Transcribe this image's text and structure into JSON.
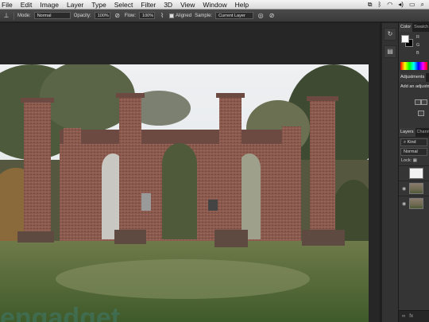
{
  "menubar": {
    "items": [
      "File",
      "Edit",
      "Image",
      "Layer",
      "Type",
      "Select",
      "Filter",
      "3D",
      "View",
      "Window",
      "Help"
    ],
    "status_icons": [
      "clone-icon",
      "bluetooth-icon",
      "wifi-icon",
      "volume-icon",
      "battery-icon",
      "search-icon"
    ]
  },
  "options_bar": {
    "tool_icon": "clone-stamp-icon",
    "mode_label": "Mode:",
    "mode_value": "Normal",
    "opacity_label": "Opacity:",
    "opacity_value": "100%",
    "flow_label": "Flow:",
    "flow_value": "100%",
    "aligned_label": "Aligned",
    "sample_label": "Sample:",
    "sample_value": "Current Layer"
  },
  "panels": {
    "tabs_top": [
      "Color",
      "Swatch"
    ],
    "rgb": [
      "R",
      "G",
      "B"
    ],
    "adjustments_tab": "Adjustments",
    "adjustments_title": "Add an adjustment",
    "layers_tabs": [
      "Layers",
      "Channels"
    ],
    "kind_label": "Kind",
    "blend_mode": "Normal",
    "lock_label": "Lock:",
    "footer_fx": "fx"
  },
  "colors": {
    "ui_dark": "#1e1e1e",
    "panel": "#353535",
    "canvas_bg": "#262626"
  }
}
